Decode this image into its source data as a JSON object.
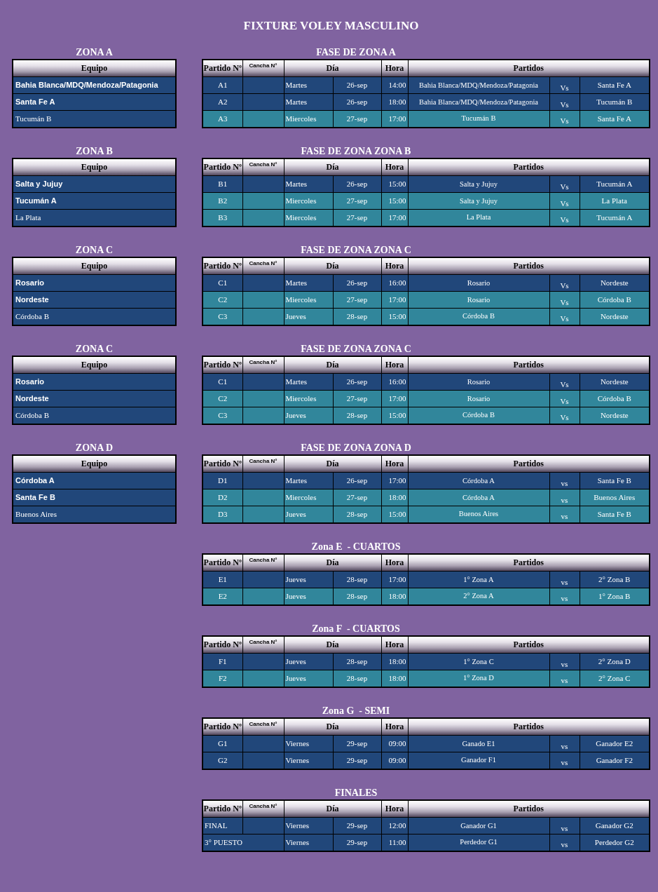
{
  "title": "FIXTURE VOLEY MASCULINO",
  "sections": [
    {
      "zone": {
        "title": "ZONA A",
        "header": "Equipo",
        "teams": [
          {
            "name": "Bahia Blanca/MDQ/Mendoza/Patagonia",
            "bold": true
          },
          {
            "name": "Santa Fe A",
            "bold": true
          },
          {
            "name": "Tucumán B",
            "bold": false
          }
        ]
      },
      "fixture": {
        "title": "FASE DE ZONA A",
        "columns": [
          "Partido Nº",
          "Cancha N°",
          "Día",
          "Hora",
          "Partidos"
        ],
        "matches": [
          {
            "number": "A1",
            "day": "Martes",
            "date": "26-sep",
            "time": "14:00",
            "home": "Bahia Blanca/MDQ/Mendoza/Patagonia",
            "vs": "Vs",
            "away": "Santa Fe A",
            "color": "#21477a"
          },
          {
            "number": "A2",
            "day": "Martes",
            "date": "26-sep",
            "time": "18:00",
            "home": "Bahia Blanca/MDQ/Mendoza/Patagonia",
            "vs": "Vs",
            "away": "Tucumán B",
            "color": "#21477a"
          },
          {
            "number": "A3",
            "day": "Miercoles",
            "date": "27-sep",
            "time": "17:00",
            "home": "Tucumán B",
            "vs": "Vs",
            "away": "Santa Fe A",
            "color": "#31869b"
          }
        ]
      }
    },
    {
      "zone": {
        "title": "ZONA B",
        "header": "Equipo",
        "teams": [
          {
            "name": "Salta y Jujuy",
            "bold": true
          },
          {
            "name": "Tucumán A",
            "bold": true
          },
          {
            "name": "La Plata",
            "bold": false
          }
        ]
      },
      "fixture": {
        "title": "FASE DE ZONA ZONA B",
        "columns": [
          "Partido Nº",
          "Cancha N°",
          "Día",
          "Hora",
          "Partidos"
        ],
        "matches": [
          {
            "number": "B1",
            "day": "Martes",
            "date": "26-sep",
            "time": "15:00",
            "home": "Salta y Jujuy",
            "vs": "Vs",
            "away": "Tucumán A",
            "color": "#21477a"
          },
          {
            "number": "B2",
            "day": "Miercoles",
            "date": "27-sep",
            "time": "15:00",
            "home": "Salta y Jujuy",
            "vs": "Vs",
            "away": "La Plata",
            "color": "#31869b"
          },
          {
            "number": "B3",
            "day": "Miercoles",
            "date": "27-sep",
            "time": "17:00",
            "home": "La Plata",
            "vs": "Vs",
            "away": "Tucumán A",
            "color": "#31869b"
          }
        ]
      }
    },
    {
      "zone": {
        "title": "ZONA C",
        "header": "Equipo",
        "teams": [
          {
            "name": "Rosario",
            "bold": true
          },
          {
            "name": "Nordeste",
            "bold": true
          },
          {
            "name": "Córdoba B",
            "bold": false
          }
        ]
      },
      "fixture": {
        "title": "FASE DE ZONA ZONA C",
        "columns": [
          "Partido Nº",
          "Cancha N°",
          "Día",
          "Hora",
          "Partidos"
        ],
        "matches": [
          {
            "number": "C1",
            "day": "Martes",
            "date": "26-sep",
            "time": "16:00",
            "home": "Rosario",
            "vs": "Vs",
            "away": "Nordeste",
            "color": "#21477a"
          },
          {
            "number": "C2",
            "day": "Miercoles",
            "date": "27-sep",
            "time": "17:00",
            "home": "Rosario",
            "vs": "Vs",
            "away": "Córdoba B",
            "color": "#31869b"
          },
          {
            "number": "C3",
            "day": "Jueves",
            "date": "28-sep",
            "time": "15:00",
            "home": "Córdoba B",
            "vs": "Vs",
            "away": "Nordeste",
            "color": "#31869b"
          }
        ]
      }
    },
    {
      "zone": {
        "title": "ZONA C",
        "header": "Equipo",
        "teams": [
          {
            "name": "Rosario",
            "bold": true
          },
          {
            "name": "Nordeste",
            "bold": true
          },
          {
            "name": "Córdoba B",
            "bold": false
          }
        ]
      },
      "fixture": {
        "title": "FASE DE ZONA ZONA C",
        "columns": [
          "Partido Nº",
          "Cancha N°",
          "Día",
          "Hora",
          "Partidos"
        ],
        "matches": [
          {
            "number": "C1",
            "day": "Martes",
            "date": "26-sep",
            "time": "16:00",
            "home": "Rosario",
            "vs": "Vs",
            "away": "Nordeste",
            "color": "#21477a"
          },
          {
            "number": "C2",
            "day": "Miercoles",
            "date": "27-sep",
            "time": "17:00",
            "home": "Rosario",
            "vs": "Vs",
            "away": "Córdoba B",
            "color": "#31869b"
          },
          {
            "number": "C3",
            "day": "Jueves",
            "date": "28-sep",
            "time": "15:00",
            "home": "Córdoba B",
            "vs": "Vs",
            "away": "Nordeste",
            "color": "#31869b"
          }
        ]
      }
    },
    {
      "zone": {
        "title": "ZONA D",
        "header": "Equipo",
        "teams": [
          {
            "name": "Córdoba A",
            "bold": true
          },
          {
            "name": "Santa Fe B",
            "bold": true
          },
          {
            "name": "Buenos Aires",
            "bold": false
          }
        ]
      },
      "fixture": {
        "title": "FASE DE ZONA ZONA D",
        "columns": [
          "Partido Nº",
          "Cancha N°",
          "Día",
          "Hora",
          "Partidos"
        ],
        "matches": [
          {
            "number": "D1",
            "day": "Martes",
            "date": "26-sep",
            "time": "17:00",
            "home": "Córdoba A",
            "vs": "vs",
            "away": "Santa Fe B",
            "color": "#21477a"
          },
          {
            "number": "D2",
            "day": "Miercoles",
            "date": "27-sep",
            "time": "18:00",
            "home": "Córdoba A",
            "vs": "vs",
            "away": "Buenos Aires",
            "color": "#31869b"
          },
          {
            "number": "D3",
            "day": "Jueves",
            "date": "28-sep",
            "time": "15:00",
            "home": "Buenos Aires",
            "vs": "vs",
            "away": "Santa Fe B",
            "color": "#31869b"
          }
        ]
      }
    },
    {
      "fixture": {
        "title": "Zona E  - CUARTOS",
        "columns": [
          "Partido Nº",
          "Cancha N°",
          "Día",
          "Hora",
          "Partidos"
        ],
        "matches": [
          {
            "number": "E1",
            "day": "Jueves",
            "date": "28-sep",
            "time": "17:00",
            "home": "1° Zona A",
            "vs": "vs",
            "away": "2° Zona B",
            "color": "#21477a"
          },
          {
            "number": "E2",
            "day": "Jueves",
            "date": "28-sep",
            "time": "18:00",
            "home": "2° Zona A",
            "vs": "vs",
            "away": "1° Zona B",
            "color": "#31869b"
          }
        ]
      }
    },
    {
      "fixture": {
        "title": "Zona F  - CUARTOS",
        "columns": [
          "Partido Nº",
          "Cancha N°",
          "Día",
          "Hora",
          "Partidos"
        ],
        "matches": [
          {
            "number": "F1",
            "day": "Jueves",
            "date": "28-sep",
            "time": "18:00",
            "home": "1° Zona C",
            "vs": "vs",
            "away": "2° Zona D",
            "color": "#21477a"
          },
          {
            "number": "F2",
            "day": "Jueves",
            "date": "28-sep",
            "time": "18:00",
            "home": "1° Zona D",
            "vs": "vs",
            "away": "2° Zona C",
            "color": "#31869b"
          }
        ]
      }
    },
    {
      "fixture": {
        "title": "Zona G  - SEMI",
        "columns": [
          "Partido Nº",
          "Cancha N°",
          "Día",
          "Hora",
          "Partidos"
        ],
        "matches": [
          {
            "number": "G1",
            "day": "Viernes",
            "date": "29-sep",
            "time": "09:00",
            "home": "Ganado E1",
            "vs": "vs",
            "away": "Ganador E2",
            "color": "#21477a"
          },
          {
            "number": "G2",
            "day": "Viernes",
            "date": "29-sep",
            "time": "09:00",
            "home": "Ganador F1",
            "vs": "vs",
            "away": "Ganador F2",
            "color": "#21477a"
          }
        ]
      }
    },
    {
      "fixture": {
        "title": "FINALES",
        "columns": [
          "Partido Nº",
          "Cancha N°",
          "Día",
          "Hora",
          "Partidos"
        ],
        "matches": [
          {
            "number": "FINAL",
            "wide": false,
            "day": "Viernes",
            "date": "29-sep",
            "time": "12:00",
            "home": "Ganador G1",
            "vs": "vs",
            "away": "Ganador G2",
            "color": "#21477a"
          },
          {
            "number": "3° PUESTO",
            "wide": true,
            "day": "Viernes",
            "date": "29-sep",
            "time": "11:00",
            "home": "Perdedor G1",
            "vs": "vs",
            "away": "Perdedor G2",
            "color": "#21477a"
          }
        ]
      }
    }
  ]
}
